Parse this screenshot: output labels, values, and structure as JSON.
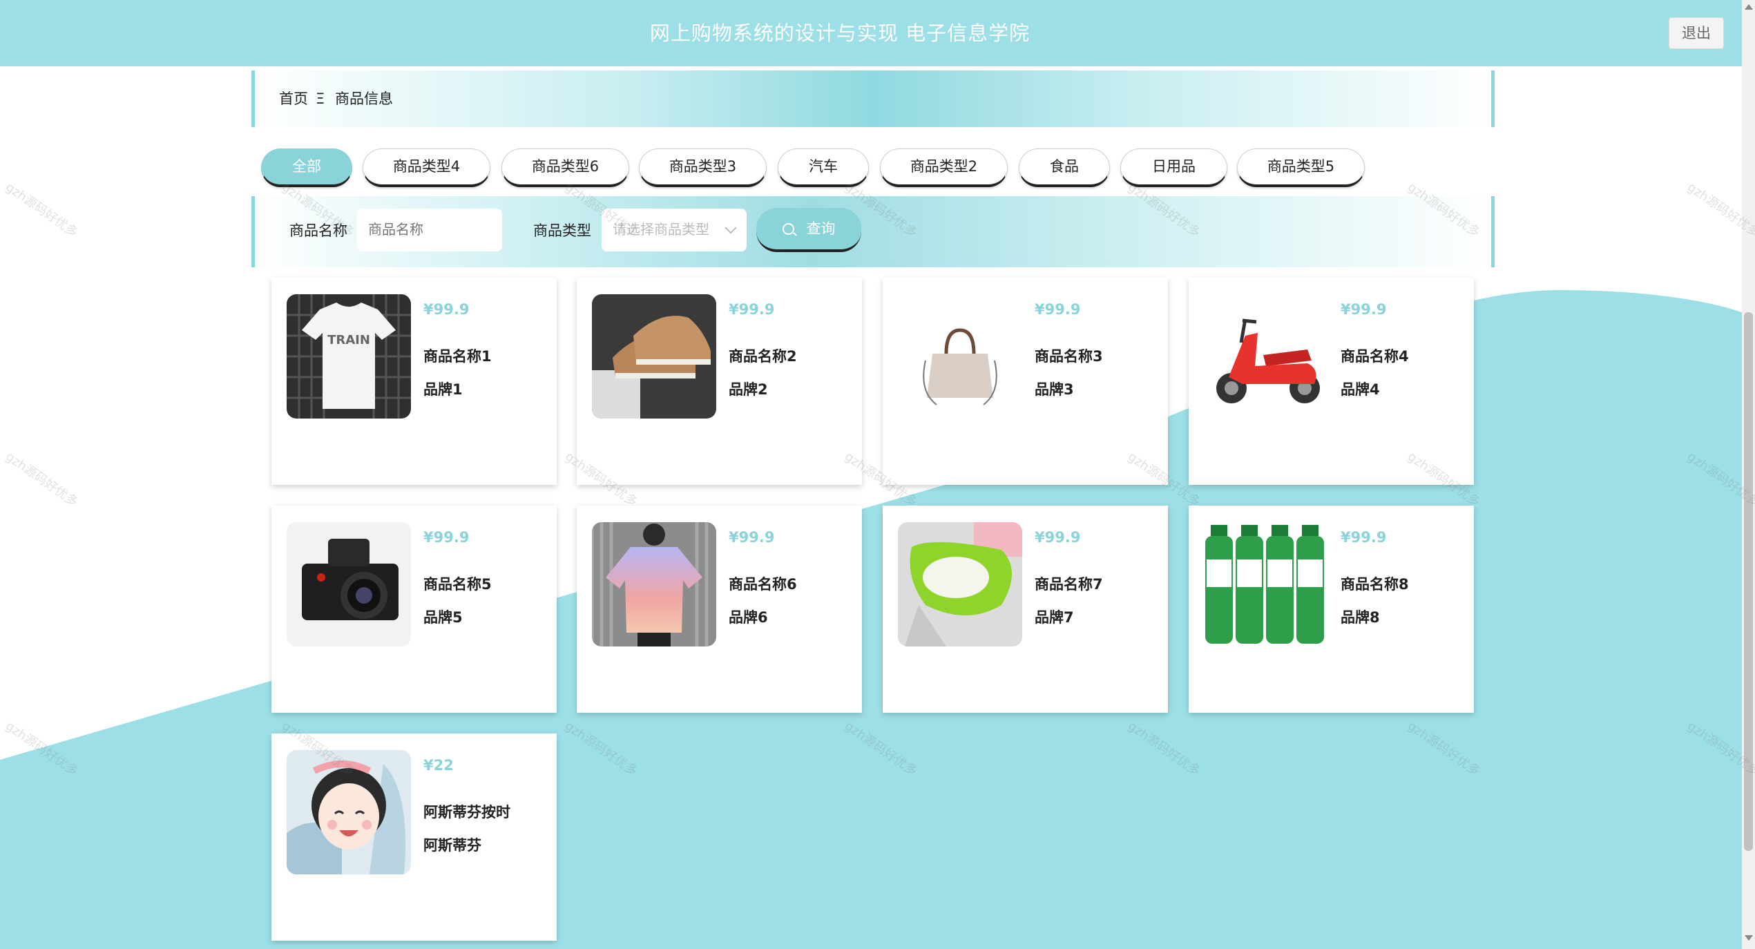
{
  "header": {
    "title": "网上购物系统的设计与实现 电子信息学院",
    "logout_label": "退出"
  },
  "breadcrumb": {
    "home": "首页",
    "separator": "Ξ",
    "current": "商品信息"
  },
  "tabs": [
    {
      "label": "全部",
      "active": true
    },
    {
      "label": "商品类型4",
      "active": false
    },
    {
      "label": "商品类型6",
      "active": false
    },
    {
      "label": "商品类型3",
      "active": false
    },
    {
      "label": "汽车",
      "active": false
    },
    {
      "label": "商品类型2",
      "active": false
    },
    {
      "label": "食品",
      "active": false
    },
    {
      "label": "日用品",
      "active": false
    },
    {
      "label": "商品类型5",
      "active": false
    }
  ],
  "search": {
    "name_label": "商品名称",
    "name_placeholder": "商品名称",
    "type_label": "商品类型",
    "type_placeholder": "请选择商品类型",
    "button_label": "查询"
  },
  "products": [
    {
      "price": "¥99.9",
      "name": "商品名称1",
      "brand": "品牌1",
      "image": "white-tshirt"
    },
    {
      "price": "¥99.9",
      "name": "商品名称2",
      "brand": "品牌2",
      "image": "brown-sneakers"
    },
    {
      "price": "¥99.9",
      "name": "商品名称3",
      "brand": "品牌3",
      "image": "handbag"
    },
    {
      "price": "¥99.9",
      "name": "商品名称4",
      "brand": "品牌4",
      "image": "red-scooter"
    },
    {
      "price": "¥99.9",
      "name": "商品名称5",
      "brand": "品牌5",
      "image": "camera"
    },
    {
      "price": "¥99.9",
      "name": "商品名称6",
      "brand": "品牌6",
      "image": "gradient-shirt"
    },
    {
      "price": "¥99.9",
      "name": "商品名称7",
      "brand": "品牌7",
      "image": "green-rice-strainer"
    },
    {
      "price": "¥99.9",
      "name": "商品名称8",
      "brand": "品牌8",
      "image": "aloe-drink-bottles"
    },
    {
      "price": "¥22",
      "name": "阿斯蒂芬按时",
      "brand": "阿斯蒂芬",
      "image": "anime-girl-illustration"
    }
  ],
  "watermark": "gzh源码好优多",
  "colors": {
    "accent": "#8ad3d9",
    "header_bg": "#9ddfe7",
    "wave": "#9ddfe7"
  }
}
